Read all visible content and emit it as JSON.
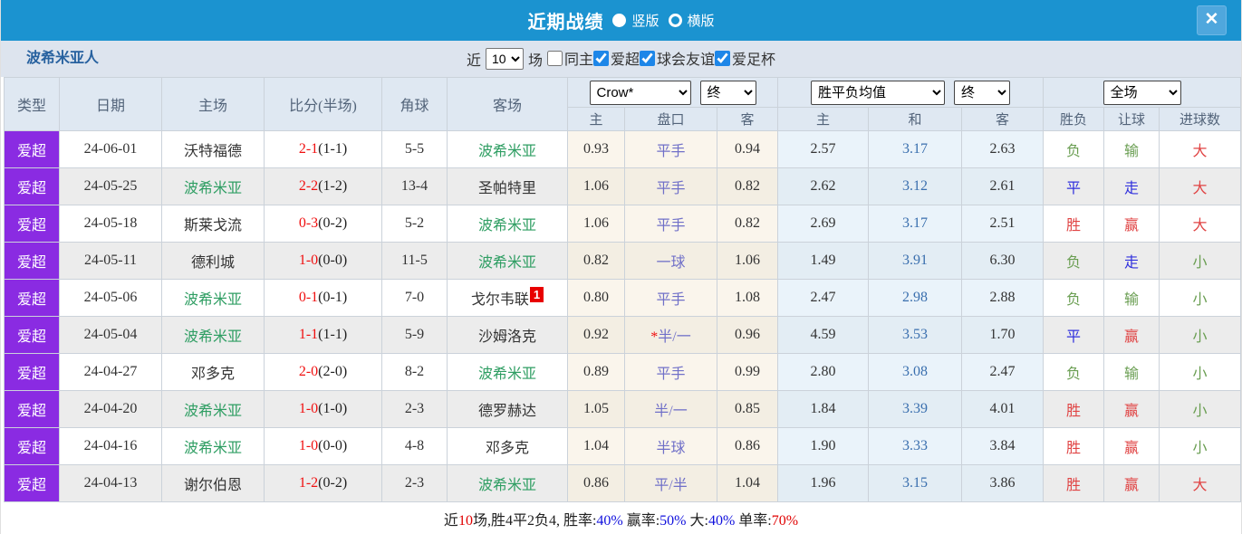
{
  "colors": {
    "titlebar_blue": "#1b93d0",
    "league_purple": "#8a2be2",
    "team_green": "#2f9e63",
    "score_red": "#f01010",
    "handicap_purple": "#7070c8",
    "draw_odds_blue": "#3a6fae",
    "win_red": "#e04444",
    "draw_blue": "#3030dd",
    "lose_green": "#6a9e52",
    "link_blue": "#1010dd",
    "highlight_red": "#e00000"
  },
  "titlebar": {
    "title": "近期战绩",
    "vertical_label": "竖版",
    "horizontal_label": "横版",
    "selected_layout": "竖版",
    "close_icon": "✕"
  },
  "filterbar": {
    "team_name": "波希米亚人",
    "near_label": "近",
    "match_count": "10",
    "matches_label": "场",
    "checkboxes": [
      {
        "label": "同主",
        "checked": false
      },
      {
        "label": "爱超",
        "checked": true
      },
      {
        "label": "球会友谊",
        "checked": true
      },
      {
        "label": "爱足杯",
        "checked": true
      }
    ]
  },
  "table": {
    "headers": {
      "league": "类型",
      "date": "日期",
      "home": "主场",
      "score": "比分(半场)",
      "corners": "角球",
      "away": "客场"
    },
    "sub": [
      "主",
      "盘口",
      "客",
      "主",
      "和",
      "客",
      "胜负",
      "让球",
      "进球数"
    ],
    "selects": {
      "company": "Crow*",
      "company_period": "终",
      "average": "胜平负均值",
      "average_period": "终",
      "scope": "全场"
    },
    "rows": [
      {
        "league": "爱超",
        "date": "24-06-01",
        "home": {
          "name": "沃特福德",
          "is_team": false
        },
        "score": {
          "full": "2-1",
          "half": "(1-1)"
        },
        "corners": "5-5",
        "away": {
          "name": "波希米亚",
          "is_team": true,
          "badge": ""
        },
        "asian": {
          "home": "0.93",
          "line": "平手",
          "star": false,
          "away": "0.94"
        },
        "europe": {
          "home": "2.57",
          "draw": "3.17",
          "away": "2.63"
        },
        "outcome": {
          "text": "负",
          "color": "green"
        },
        "handicap_result": {
          "text": "输",
          "color": "green"
        },
        "goals": {
          "text": "大",
          "color": "red"
        }
      },
      {
        "league": "爱超",
        "date": "24-05-25",
        "home": {
          "name": "波希米亚",
          "is_team": true
        },
        "score": {
          "full": "2-2",
          "half": "(1-2)"
        },
        "corners": "13-4",
        "away": {
          "name": "圣帕特里",
          "is_team": false,
          "badge": ""
        },
        "asian": {
          "home": "1.06",
          "line": "平手",
          "star": false,
          "away": "0.82"
        },
        "europe": {
          "home": "2.62",
          "draw": "3.12",
          "away": "2.61"
        },
        "outcome": {
          "text": "平",
          "color": "blue"
        },
        "handicap_result": {
          "text": "走",
          "color": "blue"
        },
        "goals": {
          "text": "大",
          "color": "red"
        }
      },
      {
        "league": "爱超",
        "date": "24-05-18",
        "home": {
          "name": "斯莱戈流",
          "is_team": false
        },
        "score": {
          "full": "0-3",
          "half": "(0-2)"
        },
        "corners": "5-2",
        "away": {
          "name": "波希米亚",
          "is_team": true,
          "badge": ""
        },
        "asian": {
          "home": "1.06",
          "line": "平手",
          "star": false,
          "away": "0.82"
        },
        "europe": {
          "home": "2.69",
          "draw": "3.17",
          "away": "2.51"
        },
        "outcome": {
          "text": "胜",
          "color": "red"
        },
        "handicap_result": {
          "text": "赢",
          "color": "red"
        },
        "goals": {
          "text": "大",
          "color": "red"
        }
      },
      {
        "league": "爱超",
        "date": "24-05-11",
        "home": {
          "name": "德利城",
          "is_team": false
        },
        "score": {
          "full": "1-0",
          "half": "(0-0)"
        },
        "corners": "11-5",
        "away": {
          "name": "波希米亚",
          "is_team": true,
          "badge": ""
        },
        "asian": {
          "home": "0.82",
          "line": "一球",
          "star": false,
          "away": "1.06"
        },
        "europe": {
          "home": "1.49",
          "draw": "3.91",
          "away": "6.30"
        },
        "outcome": {
          "text": "负",
          "color": "green"
        },
        "handicap_result": {
          "text": "走",
          "color": "blue"
        },
        "goals": {
          "text": "小",
          "color": "green"
        }
      },
      {
        "league": "爱超",
        "date": "24-05-06",
        "home": {
          "name": "波希米亚",
          "is_team": true
        },
        "score": {
          "full": "0-1",
          "half": "(0-1)"
        },
        "corners": "7-0",
        "away": {
          "name": "戈尔韦联",
          "is_team": false,
          "badge": "1"
        },
        "asian": {
          "home": "0.80",
          "line": "平手",
          "star": false,
          "away": "1.08"
        },
        "europe": {
          "home": "2.47",
          "draw": "2.98",
          "away": "2.88"
        },
        "outcome": {
          "text": "负",
          "color": "green"
        },
        "handicap_result": {
          "text": "输",
          "color": "green"
        },
        "goals": {
          "text": "小",
          "color": "green"
        }
      },
      {
        "league": "爱超",
        "date": "24-05-04",
        "home": {
          "name": "波希米亚",
          "is_team": true
        },
        "score": {
          "full": "1-1",
          "half": "(1-1)"
        },
        "corners": "5-9",
        "away": {
          "name": "沙姆洛克",
          "is_team": false,
          "badge": ""
        },
        "asian": {
          "home": "0.92",
          "line": "半/一",
          "star": true,
          "away": "0.96"
        },
        "europe": {
          "home": "4.59",
          "draw": "3.53",
          "away": "1.70"
        },
        "outcome": {
          "text": "平",
          "color": "blue"
        },
        "handicap_result": {
          "text": "赢",
          "color": "red"
        },
        "goals": {
          "text": "小",
          "color": "green"
        }
      },
      {
        "league": "爱超",
        "date": "24-04-27",
        "home": {
          "name": "邓多克",
          "is_team": false
        },
        "score": {
          "full": "2-0",
          "half": "(2-0)"
        },
        "corners": "8-2",
        "away": {
          "name": "波希米亚",
          "is_team": true,
          "badge": ""
        },
        "asian": {
          "home": "0.89",
          "line": "平手",
          "star": false,
          "away": "0.99"
        },
        "europe": {
          "home": "2.80",
          "draw": "3.08",
          "away": "2.47"
        },
        "outcome": {
          "text": "负",
          "color": "green"
        },
        "handicap_result": {
          "text": "输",
          "color": "green"
        },
        "goals": {
          "text": "小",
          "color": "green"
        }
      },
      {
        "league": "爱超",
        "date": "24-04-20",
        "home": {
          "name": "波希米亚",
          "is_team": true
        },
        "score": {
          "full": "1-0",
          "half": "(1-0)"
        },
        "corners": "2-3",
        "away": {
          "name": "德罗赫达",
          "is_team": false,
          "badge": ""
        },
        "asian": {
          "home": "1.05",
          "line": "半/一",
          "star": false,
          "away": "0.85"
        },
        "europe": {
          "home": "1.84",
          "draw": "3.39",
          "away": "4.01"
        },
        "outcome": {
          "text": "胜",
          "color": "red"
        },
        "handicap_result": {
          "text": "赢",
          "color": "red"
        },
        "goals": {
          "text": "小",
          "color": "green"
        }
      },
      {
        "league": "爱超",
        "date": "24-04-16",
        "home": {
          "name": "波希米亚",
          "is_team": true
        },
        "score": {
          "full": "1-0",
          "half": "(0-0)"
        },
        "corners": "4-8",
        "away": {
          "name": "邓多克",
          "is_team": false,
          "badge": ""
        },
        "asian": {
          "home": "1.04",
          "line": "半球",
          "star": false,
          "away": "0.86"
        },
        "europe": {
          "home": "1.90",
          "draw": "3.33",
          "away": "3.84"
        },
        "outcome": {
          "text": "胜",
          "color": "red"
        },
        "handicap_result": {
          "text": "赢",
          "color": "red"
        },
        "goals": {
          "text": "小",
          "color": "green"
        }
      },
      {
        "league": "爱超",
        "date": "24-04-13",
        "home": {
          "name": "谢尔伯恩",
          "is_team": false
        },
        "score": {
          "full": "1-2",
          "half": "(0-2)"
        },
        "corners": "2-3",
        "away": {
          "name": "波希米亚",
          "is_team": true,
          "badge": ""
        },
        "asian": {
          "home": "0.86",
          "line": "平/半",
          "star": false,
          "away": "1.04"
        },
        "europe": {
          "home": "1.96",
          "draw": "3.15",
          "away": "3.86"
        },
        "outcome": {
          "text": "胜",
          "color": "red"
        },
        "handicap_result": {
          "text": "赢",
          "color": "red"
        },
        "goals": {
          "text": "大",
          "color": "red"
        }
      }
    ]
  },
  "footer": {
    "segments": [
      {
        "text": "近",
        "color": "default"
      },
      {
        "text": "10",
        "color": "red"
      },
      {
        "text": "场,胜4平2负4, 胜率:",
        "color": "default"
      },
      {
        "text": "40%",
        "color": "blue"
      },
      {
        "text": " 赢率:",
        "color": "default"
      },
      {
        "text": "50%",
        "color": "blue"
      },
      {
        "text": " 大:",
        "color": "default"
      },
      {
        "text": "40%",
        "color": "blue"
      },
      {
        "text": " 单率:",
        "color": "default"
      },
      {
        "text": "70%",
        "color": "red"
      }
    ]
  }
}
